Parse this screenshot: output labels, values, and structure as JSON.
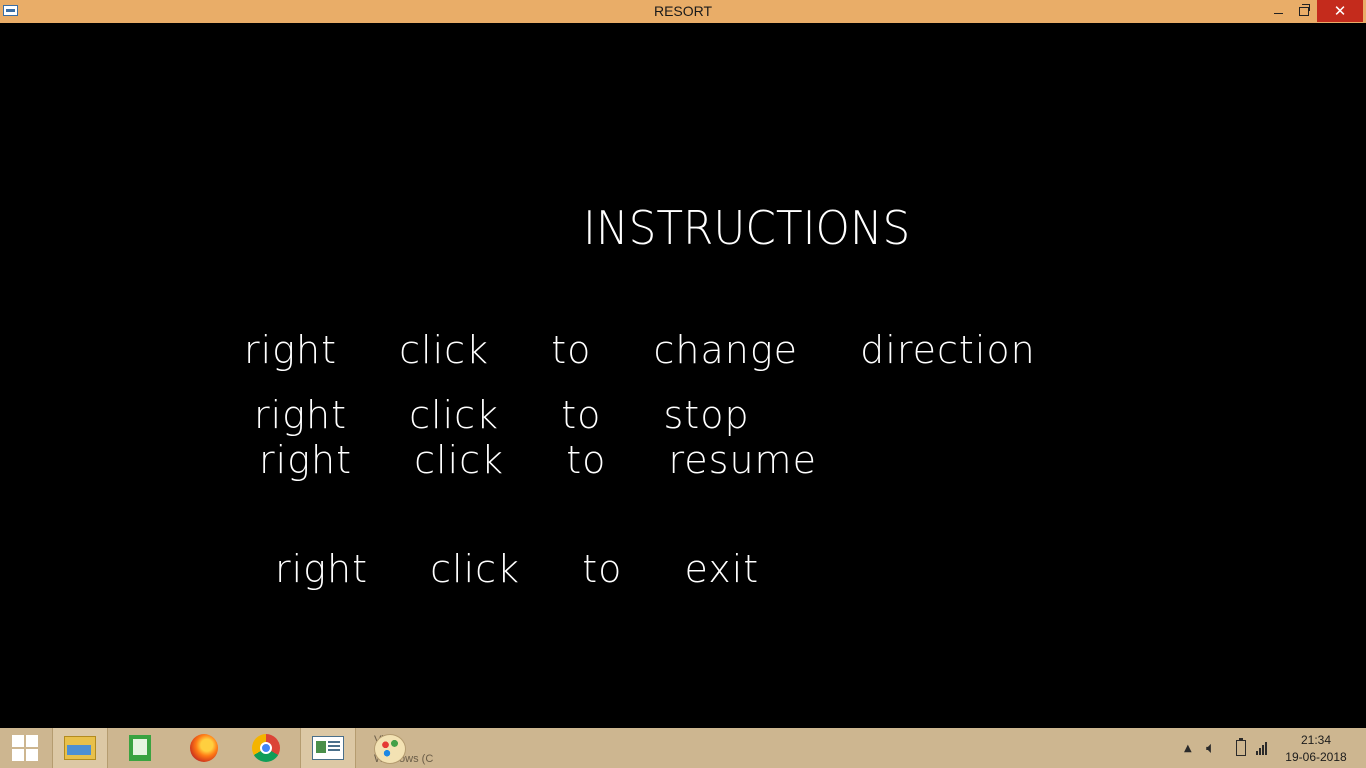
{
  "window": {
    "title": "RESORT",
    "close_glyph": "✕"
  },
  "screen": {
    "heading": "INSTRUCTIONS",
    "lines": [
      "right  click  to  change  direction",
      "right  click  to  stop",
      "right  click  to  resume",
      "right  click  to  exit"
    ]
  },
  "taskbar": {
    "apps": [
      {
        "name": "start",
        "icon": "windows-logo-icon"
      },
      {
        "name": "file-explorer",
        "icon": "folder-icon"
      },
      {
        "name": "notepad-plus-plus",
        "icon": "notepad-icon"
      },
      {
        "name": "firefox",
        "icon": "firefox-icon"
      },
      {
        "name": "chrome",
        "icon": "chrome-icon"
      },
      {
        "name": "resort",
        "icon": "app-window-icon"
      },
      {
        "name": "paint",
        "icon": "paint-palette-icon"
      }
    ],
    "partial_text_top": "Vi  s",
    "partial_text_bottom": "Windows (C",
    "clock": {
      "time": "21:34",
      "date": "19-06-2018"
    }
  }
}
